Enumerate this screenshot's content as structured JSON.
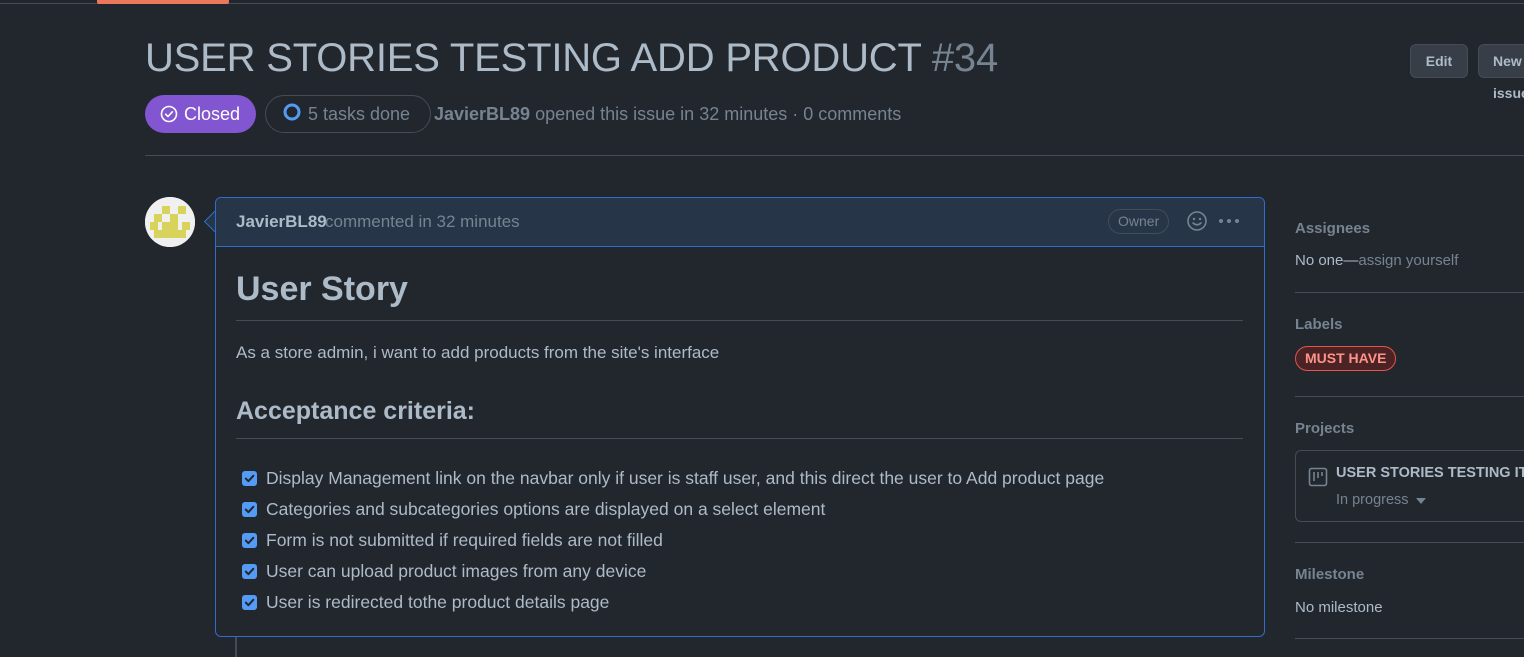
{
  "issue": {
    "title": "USER STORIES TESTING ADD PRODUCT",
    "number": "#34",
    "state": "Closed",
    "tasks": "5 tasks done",
    "author": "JavierBL89",
    "meta_rest": " opened this issue in 32 minutes · 0 comments"
  },
  "header_buttons": {
    "edit": "Edit",
    "new": "New issue"
  },
  "comment": {
    "author": "JavierBL89",
    "time": "commented in 32 minutes",
    "role": "Owner",
    "heading": "User Story",
    "story": "As a store admin, i want to add products from the site's interface",
    "criteria_heading": "Acceptance criteria:",
    "tasks": [
      {
        "text": "Display Management link on the navbar only if user is staff user, and this direct the user to Add product page",
        "checked": true
      },
      {
        "text": "Categories and subcategories options are displayed on a select element",
        "checked": true
      },
      {
        "text": "Form is not submitted if required fields are not filled",
        "checked": true
      },
      {
        "text": "User can upload product images from any device",
        "checked": true
      },
      {
        "text": "User is redirected tothe product details page",
        "checked": true
      }
    ]
  },
  "sidebar": {
    "assignees_heading": "Assignees",
    "assignees_none": "No one—",
    "assign_yourself": "assign yourself",
    "labels_heading": "Labels",
    "label": "MUST HAVE",
    "projects_heading": "Projects",
    "project_name": "USER STORIES TESTING ITERATION",
    "project_status": "In progress",
    "milestone_heading": "Milestone",
    "milestone_value": "No milestone"
  },
  "colors": {
    "background": "#22272e",
    "closed_badge": "#8256d0",
    "accent_blue": "#316dca",
    "checkbox": "#539bf5",
    "label_border": "#e5534b",
    "tab_underline": "#ec775c"
  }
}
